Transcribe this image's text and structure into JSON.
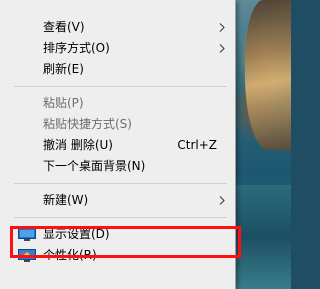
{
  "context_menu": {
    "items": [
      {
        "label": "查看(V)",
        "has_submenu": true
      },
      {
        "label": "排序方式(O)",
        "has_submenu": true
      },
      {
        "label": "刷新(E)"
      },
      {
        "label": "粘贴(P)",
        "disabled": true
      },
      {
        "label": "粘贴快捷方式(S)",
        "disabled": true
      },
      {
        "label": "撤消 删除(U)",
        "shortcut": "Ctrl+Z"
      },
      {
        "label": "下一个桌面背景(N)"
      },
      {
        "label": "新建(W)",
        "has_submenu": true
      },
      {
        "label": "显示设置(D)",
        "icon": "display-icon",
        "highlighted": true
      },
      {
        "label": "个性化(R)",
        "icon": "personalize-icon"
      }
    ]
  },
  "colors": {
    "menu_background": "#eeeeee",
    "disabled_text": "#6d6d6d",
    "highlight_border": "#ff1010"
  }
}
